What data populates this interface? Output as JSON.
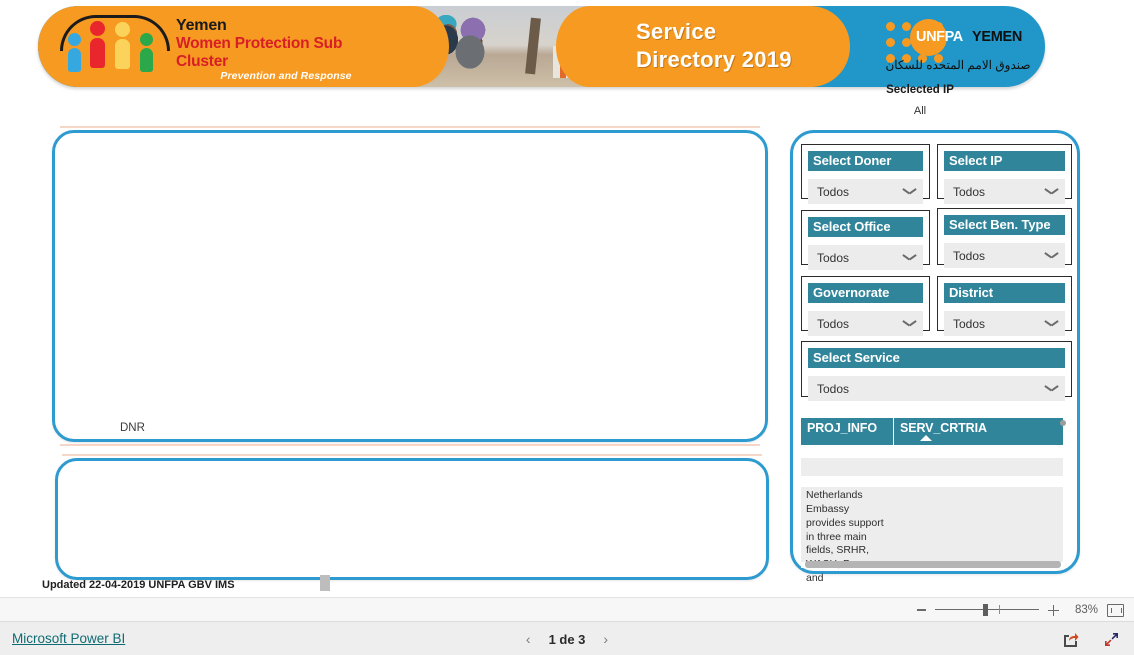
{
  "banner": {
    "logo": {
      "line1": "Yemen",
      "line2": "Women Protection Sub Cluster",
      "line3": "Prevention and Response",
      "icon_name": "four-people-arc-logo"
    },
    "title_line1": "Service",
    "title_line2": "Directory 2019",
    "unfpa": {
      "mark": "UNFPA",
      "country": "YEMEN",
      "arabic": "صندوق الامم المتحده للسكان"
    }
  },
  "selected_ip": {
    "title": "Seclected IP",
    "value": "All"
  },
  "canvas": {
    "dnr_label": "DNR",
    "footer_note": "Updated 22-04-2019  UNFPA GBV IMS"
  },
  "slicers": [
    {
      "title": "Select Doner",
      "value": "Todos"
    },
    {
      "title": "Select IP",
      "value": "Todos"
    },
    {
      "title": "Select Office",
      "value": "Todos"
    },
    {
      "title": "Select Ben. Type",
      "value": "Todos"
    },
    {
      "title": "Governorate",
      "value": "Todos"
    },
    {
      "title": "District",
      "value": "Todos"
    },
    {
      "title": "Select Service",
      "value": "Todos"
    }
  ],
  "table": {
    "columns": [
      "PROJ_INFO",
      "SERV_CRTRIA"
    ],
    "sorted_column": "SERV_CRTRIA",
    "sort_direction": "ascending",
    "rows": [
      {
        "proj_info": "",
        "serv_crtria": ""
      },
      {
        "proj_info": "",
        "serv_crtria": ""
      },
      {
        "proj_info": "Netherlands Embassy provides support in three main fields, SRHR, WASH, Peace and",
        "serv_crtria": ""
      }
    ]
  },
  "statusbar": {
    "zoom_percent": "83%",
    "zoom_out_name": "zoom-out-button",
    "zoom_in_name": "zoom-in-button",
    "fit_name": "fit-to-page-button"
  },
  "bottombar": {
    "brand_link": "Microsoft Power BI",
    "prev": "‹",
    "next": "›",
    "page_label": "1 de 3"
  },
  "colors": {
    "brand_orange": "#f79a21",
    "brand_blue": "#2196c8",
    "slicer_header_teal": "#31859b",
    "panel_border_blue": "#2e9bd0",
    "logo_red": "#d81e26",
    "link_teal": "#0f6b72"
  }
}
